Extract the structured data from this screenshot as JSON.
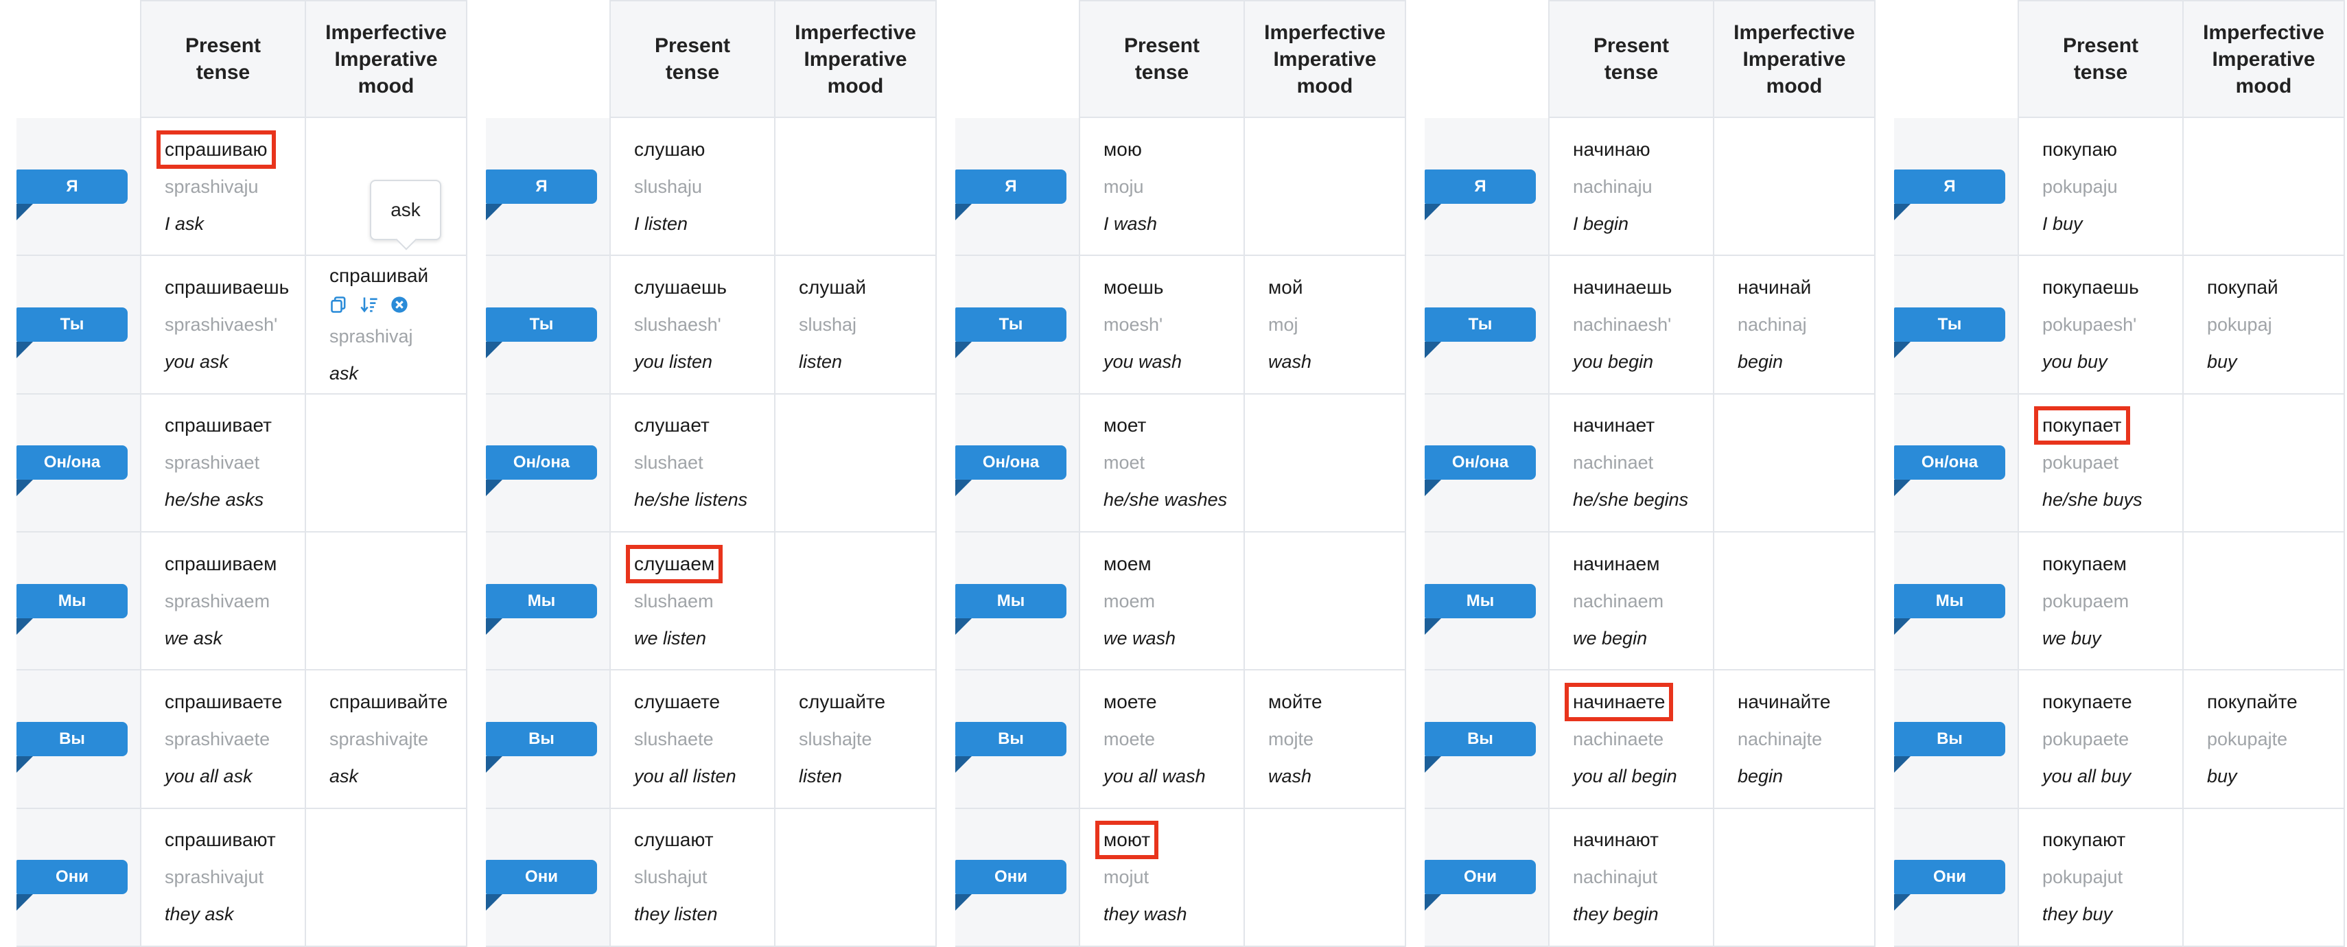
{
  "headers": {
    "present": "Present\ntense",
    "imperative": "Imperfective\nImperative\nmood"
  },
  "pronouns": [
    "Я",
    "Ты",
    "Он/она",
    "Мы",
    "Вы",
    "Они"
  ],
  "tooltip": {
    "text": "ask"
  },
  "panels": [
    {
      "verb": "ask",
      "present": [
        {
          "ru": "спрашиваю",
          "tr": "sprashivaju",
          "en": "I ask",
          "highlight": true
        },
        {
          "ru": "спрашиваешь",
          "tr": "sprashivaesh'",
          "en": "you ask"
        },
        {
          "ru": "спрашивает",
          "tr": "sprashivaet",
          "en": "he/she asks"
        },
        {
          "ru": "спрашиваем",
          "tr": "sprashivaem",
          "en": "we ask"
        },
        {
          "ru": "спрашиваете",
          "tr": "sprashivaete",
          "en": "you all ask"
        },
        {
          "ru": "спрашивают",
          "tr": "sprashivajut",
          "en": "they ask"
        }
      ],
      "imperative": [
        null,
        {
          "ru": "спрашивай",
          "tr": "sprashivaj",
          "en": "ask",
          "icons": [
            "copy-icon",
            "sort-icon",
            "close-circle-icon"
          ]
        },
        null,
        null,
        {
          "ru": "спрашивайте",
          "tr": "sprashivajte",
          "en": "ask"
        },
        null
      ]
    },
    {
      "verb": "listen",
      "present": [
        {
          "ru": "слушаю",
          "tr": "slushaju",
          "en": "I listen"
        },
        {
          "ru": "слушаешь",
          "tr": "slushaesh'",
          "en": "you listen"
        },
        {
          "ru": "слушает",
          "tr": "slushaet",
          "en": "he/she listens"
        },
        {
          "ru": "слушаем",
          "tr": "slushaem",
          "en": "we listen",
          "highlight": true
        },
        {
          "ru": "слушаете",
          "tr": "slushaete",
          "en": "you all listen"
        },
        {
          "ru": "слушают",
          "tr": "slushajut",
          "en": "they listen"
        }
      ],
      "imperative": [
        null,
        {
          "ru": "слушай",
          "tr": "slushaj",
          "en": "listen"
        },
        null,
        null,
        {
          "ru": "слушайте",
          "tr": "slushajte",
          "en": "listen"
        },
        null
      ]
    },
    {
      "verb": "wash",
      "present": [
        {
          "ru": "мою",
          "tr": "moju",
          "en": "I wash"
        },
        {
          "ru": "моешь",
          "tr": "moesh'",
          "en": "you wash"
        },
        {
          "ru": "моет",
          "tr": "moet",
          "en": "he/she washes"
        },
        {
          "ru": "моем",
          "tr": "moem",
          "en": "we wash"
        },
        {
          "ru": "моете",
          "tr": "moete",
          "en": "you all wash"
        },
        {
          "ru": "моют",
          "tr": "mojut",
          "en": "they wash",
          "highlight": true
        }
      ],
      "imperative": [
        null,
        {
          "ru": "мой",
          "tr": "moj",
          "en": "wash"
        },
        null,
        null,
        {
          "ru": "мойте",
          "tr": "mojte",
          "en": "wash"
        },
        null
      ]
    },
    {
      "verb": "begin",
      "present": [
        {
          "ru": "начинаю",
          "tr": "nachinaju",
          "en": "I begin"
        },
        {
          "ru": "начинаешь",
          "tr": "nachinaesh'",
          "en": "you begin"
        },
        {
          "ru": "начинает",
          "tr": "nachinaet",
          "en": "he/she begins"
        },
        {
          "ru": "начинаем",
          "tr": "nachinaem",
          "en": "we begin"
        },
        {
          "ru": "начинаете",
          "tr": "nachinaete",
          "en": "you all begin",
          "highlight": true
        },
        {
          "ru": "начинают",
          "tr": "nachinajut",
          "en": "they begin"
        }
      ],
      "imperative": [
        null,
        {
          "ru": "начинай",
          "tr": "nachinaj",
          "en": "begin"
        },
        null,
        null,
        {
          "ru": "начинайте",
          "tr": "nachinajte",
          "en": "begin"
        },
        null
      ]
    },
    {
      "verb": "buy",
      "present": [
        {
          "ru": "покупаю",
          "tr": "pokupaju",
          "en": "I buy"
        },
        {
          "ru": "покупаешь",
          "tr": "pokupaesh'",
          "en": "you buy"
        },
        {
          "ru": "покупает",
          "tr": "pokupaet",
          "en": "he/she buys",
          "highlight": true
        },
        {
          "ru": "покупаем",
          "tr": "pokupaem",
          "en": "we buy"
        },
        {
          "ru": "покупаете",
          "tr": "pokupaete",
          "en": "you all buy"
        },
        {
          "ru": "покупают",
          "tr": "pokupajut",
          "en": "they buy"
        }
      ],
      "imperative": [
        null,
        {
          "ru": "покупай",
          "tr": "pokupaj",
          "en": "buy"
        },
        null,
        null,
        {
          "ru": "покупайте",
          "tr": "pokupajte",
          "en": "buy"
        },
        null
      ]
    }
  ],
  "colors": {
    "badge": "#2a8bd8",
    "badge_fold": "#1c5f99",
    "highlight": "#e8341c",
    "icon": "#2a8bd8"
  }
}
